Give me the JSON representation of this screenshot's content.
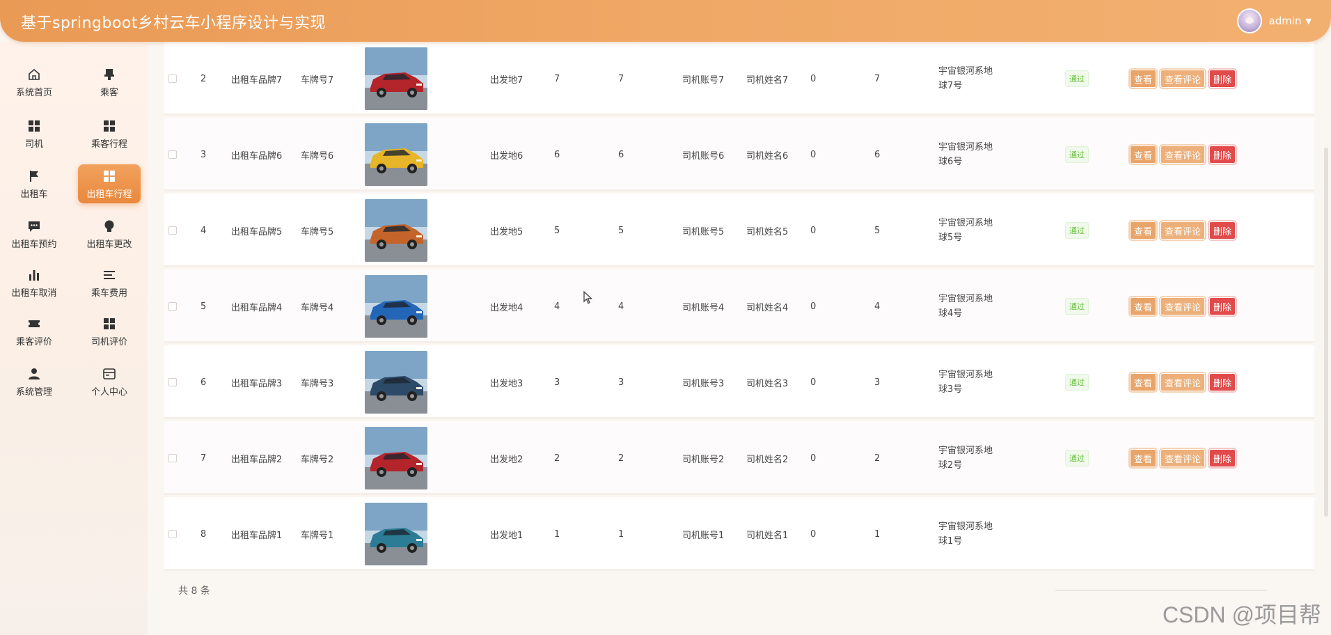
{
  "header": {
    "title": "基于springboot乡村云车小程序设计与实现",
    "username": "admin"
  },
  "sidebar": {
    "items": [
      {
        "label": "系统首页",
        "icon": "home-icon"
      },
      {
        "label": "乘客",
        "icon": "stamp-icon"
      },
      {
        "label": "司机",
        "icon": "grid-icon"
      },
      {
        "label": "乘客行程",
        "icon": "grid-icon"
      },
      {
        "label": "出租车",
        "icon": "flag-icon"
      },
      {
        "label": "出租车行程",
        "icon": "grid-icon",
        "active": true
      },
      {
        "label": "出租车预约",
        "icon": "chat-icon"
      },
      {
        "label": "出租车更改",
        "icon": "bulb-icon"
      },
      {
        "label": "出租车取消",
        "icon": "bar-chart-icon"
      },
      {
        "label": "乘车费用",
        "icon": "list-icon"
      },
      {
        "label": "乘客评价",
        "icon": "ticket-icon"
      },
      {
        "label": "司机评价",
        "icon": "grid-icon"
      },
      {
        "label": "系统管理",
        "icon": "user-icon"
      },
      {
        "label": "个人中心",
        "icon": "card-icon"
      }
    ]
  },
  "table": {
    "rows": [
      {
        "index": "2",
        "brand": "出租车品牌7",
        "plate": "车牌号7",
        "car_color": "#b3242b",
        "origin": "出发地7",
        "c1": "7",
        "c2": "7",
        "account": "司机账号7",
        "name": "司机姓名7",
        "c3": "0",
        "c4": "7",
        "addr1": "宇宙银河系地",
        "addr2": "球7号",
        "status": "通过",
        "has_actions": true
      },
      {
        "index": "3",
        "brand": "出租车品牌6",
        "plate": "车牌号6",
        "car_color": "#e7b528",
        "origin": "出发地6",
        "c1": "6",
        "c2": "6",
        "account": "司机账号6",
        "name": "司机姓名6",
        "c3": "0",
        "c4": "6",
        "addr1": "宇宙银河系地",
        "addr2": "球6号",
        "status": "通过",
        "has_actions": true
      },
      {
        "index": "4",
        "brand": "出租车品牌5",
        "plate": "车牌号5",
        "car_color": "#c4642a",
        "origin": "出发地5",
        "c1": "5",
        "c2": "5",
        "account": "司机账号5",
        "name": "司机姓名5",
        "c3": "0",
        "c4": "5",
        "addr1": "宇宙银河系地",
        "addr2": "球5号",
        "status": "通过",
        "has_actions": true
      },
      {
        "index": "5",
        "brand": "出租车品牌4",
        "plate": "车牌号4",
        "car_color": "#2366b8",
        "origin": "出发地4",
        "c1": "4",
        "c2": "4",
        "account": "司机账号4",
        "name": "司机姓名4",
        "c3": "0",
        "c4": "4",
        "addr1": "宇宙银河系地",
        "addr2": "球4号",
        "status": "通过",
        "has_actions": true
      },
      {
        "index": "6",
        "brand": "出租车品牌3",
        "plate": "车牌号3",
        "car_color": "#2d4a68",
        "origin": "出发地3",
        "c1": "3",
        "c2": "3",
        "account": "司机账号3",
        "name": "司机姓名3",
        "c3": "0",
        "c4": "3",
        "addr1": "宇宙银河系地",
        "addr2": "球3号",
        "status": "通过",
        "has_actions": true
      },
      {
        "index": "7",
        "brand": "出租车品牌2",
        "plate": "车牌号2",
        "car_color": "#b3242b",
        "origin": "出发地2",
        "c1": "2",
        "c2": "2",
        "account": "司机账号2",
        "name": "司机姓名2",
        "c3": "0",
        "c4": "2",
        "addr1": "宇宙银河系地",
        "addr2": "球2号",
        "status": "通过",
        "has_actions": true
      },
      {
        "index": "8",
        "brand": "出租车品牌1",
        "plate": "车牌号1",
        "car_color": "#2b7c94",
        "origin": "出发地1",
        "c1": "1",
        "c2": "1",
        "account": "司机账号1",
        "name": "司机姓名1",
        "c3": "0",
        "c4": "1",
        "addr1": "宇宙银河系地",
        "addr2": "球1号",
        "status": "",
        "has_actions": false
      }
    ],
    "actions": {
      "view": "查看",
      "review": "查看评论",
      "delete": "删除"
    }
  },
  "footer": {
    "total": "共 8 条"
  },
  "watermark": "CSDN @项目帮",
  "colors": {
    "accent": "#ea9447",
    "danger": "#e14b4b",
    "success": "#67c23a"
  }
}
